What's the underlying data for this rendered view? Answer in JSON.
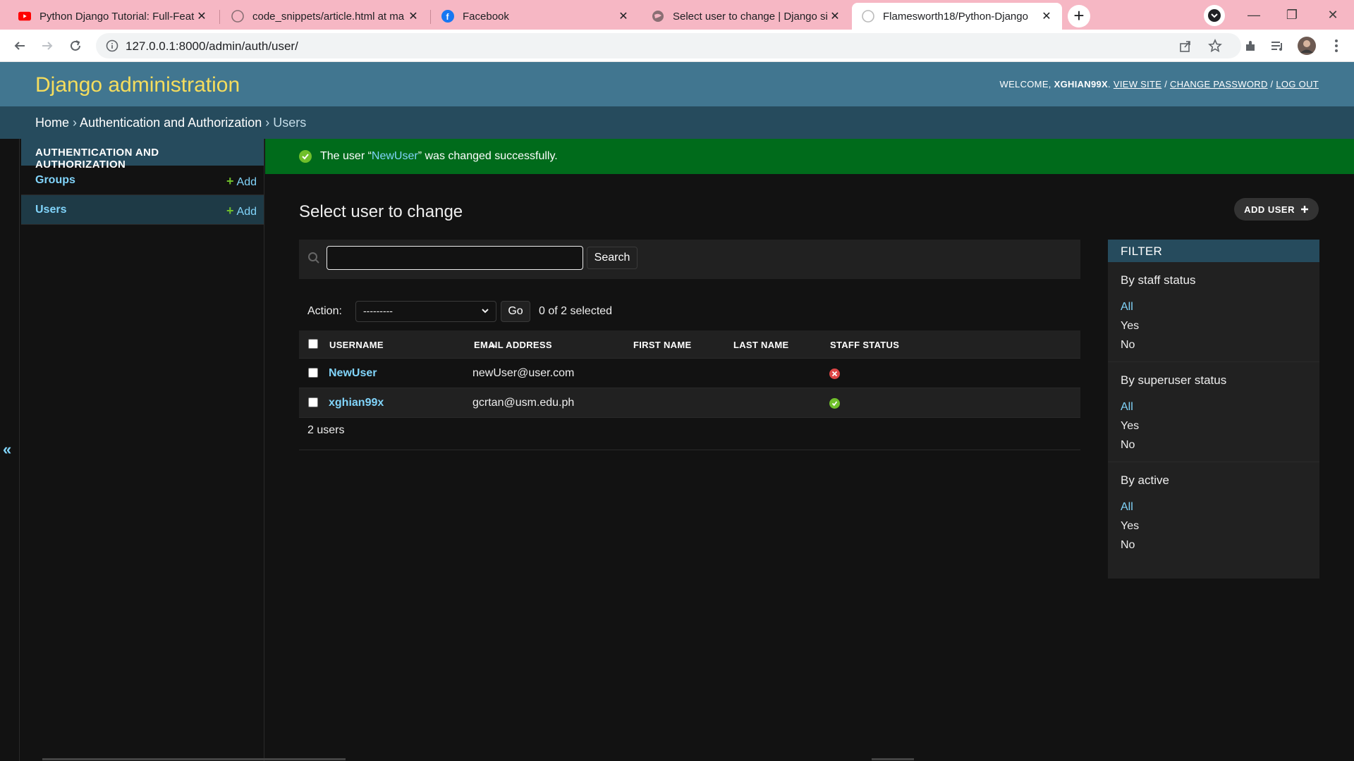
{
  "browser": {
    "tabs": [
      {
        "title": "Python Django Tutorial: Full-Feat",
        "icon": "youtube-icon"
      },
      {
        "title": "code_snippets/article.html at ma",
        "icon": "github-icon"
      },
      {
        "title": "Facebook",
        "icon": "facebook-icon"
      },
      {
        "title": "Select user to change | Django si",
        "icon": "globe-icon"
      },
      {
        "title": "Flamesworth18/Python-Django",
        "icon": "github-icon"
      }
    ],
    "url": "127.0.0.1:8000/admin/auth/user/"
  },
  "header": {
    "branding": "Django administration",
    "welcome": "WELCOME,",
    "username": "XGHIAN99X",
    "view_site": "VIEW SITE",
    "change_password": "CHANGE PASSWORD",
    "log_out": "LOG OUT"
  },
  "breadcrumbs": {
    "home": "Home",
    "app": "Authentication and Authorization",
    "current": "Users",
    "sep": "›"
  },
  "sidebar": {
    "toggle": "«",
    "module_caption": "AUTHENTICATION AND AUTHORIZATION",
    "items": [
      {
        "name": "Groups",
        "add": "Add"
      },
      {
        "name": "Users",
        "add": "Add"
      }
    ]
  },
  "message": {
    "prefix": "The user “",
    "link": "NewUser",
    "suffix": "” was changed successfully."
  },
  "page": {
    "title": "Select user to change",
    "add_button": "ADD USER",
    "search_button": "Search",
    "search_value": "",
    "action_label": "Action:",
    "action_selected": "---------",
    "go_button": "Go",
    "counter": "0 of 2 selected",
    "paginator": "2 users"
  },
  "table": {
    "columns": [
      "USERNAME",
      "EMAIL ADDRESS",
      "FIRST NAME",
      "LAST NAME",
      "STAFF STATUS"
    ],
    "rows": [
      {
        "username": "NewUser",
        "email": "newUser@user.com",
        "first_name": "",
        "last_name": "",
        "staff": false
      },
      {
        "username": "xghian99x",
        "email": "gcrtan@usm.edu.ph",
        "first_name": "",
        "last_name": "",
        "staff": true
      }
    ]
  },
  "filter": {
    "title": "FILTER",
    "groups": [
      {
        "title": "By staff status",
        "options": [
          "All",
          "Yes",
          "No"
        ],
        "selected": 0
      },
      {
        "title": "By superuser status",
        "options": [
          "All",
          "Yes",
          "No"
        ],
        "selected": 0
      },
      {
        "title": "By active",
        "options": [
          "All",
          "Yes",
          "No"
        ],
        "selected": 0
      }
    ]
  },
  "colors": {
    "header": "#417690",
    "breadcrumbs": "#264b5d",
    "branding": "#f5dd5d",
    "link": "#81d4fa",
    "success": "#006b1b",
    "true_icon": "#70bf2b",
    "false_icon": "#dd4646"
  }
}
